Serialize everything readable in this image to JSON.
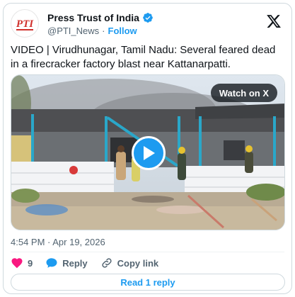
{
  "account": {
    "display_name": "Press Trust of India",
    "handle": "@PTI_News",
    "separator": "·",
    "follow_label": "Follow",
    "avatar_text": "PTI"
  },
  "tweet": {
    "text": "VIDEO | Virudhunagar, Tamil Nadu: Several feared dead in a firecracker factory blast near Kattanarpatti.",
    "timestamp": "4:54 PM · Apr 19, 2026"
  },
  "media": {
    "watch_label": "Watch on X"
  },
  "actions": {
    "like_count": "9",
    "reply_label": "Reply",
    "copy_label": "Copy link"
  },
  "read_replies_label": "Read 1 reply",
  "colors": {
    "accent": "#1d9bf0",
    "like": "#f91880",
    "text": "#0f1419",
    "muted": "#536471"
  }
}
